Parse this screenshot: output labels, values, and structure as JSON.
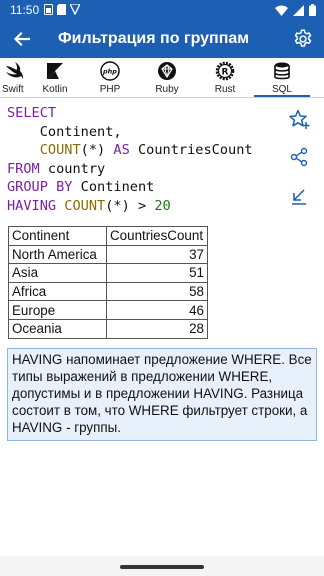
{
  "status_bar": {
    "time": "11:50",
    "icons": [
      "sim-icon",
      "sd-card-icon",
      "vpn-shield-icon",
      "wifi-icon",
      "signal-icon",
      "battery-icon"
    ]
  },
  "app_bar": {
    "title": "Фильтрация по группам",
    "back_icon": "arrow-left-icon",
    "settings_icon": "gear-icon"
  },
  "tabs": [
    {
      "label": "Swift",
      "icon": "swift-icon"
    },
    {
      "label": "Kotlin",
      "icon": "kotlin-icon"
    },
    {
      "label": "PHP",
      "icon": "php-icon"
    },
    {
      "label": "Ruby",
      "icon": "ruby-icon"
    },
    {
      "label": "Rust",
      "icon": "rust-icon"
    },
    {
      "label": "SQL",
      "icon": "database-icon",
      "active": true
    }
  ],
  "code": {
    "line1_kw": "SELECT",
    "line2_text": "    Continent,",
    "line3_indent": "    ",
    "line3_fn": "COUNT",
    "line3_args": "(*) ",
    "line3_kw": "AS",
    "line3_alias": " CountriesCount",
    "line4_kw": "FROM",
    "line4_text": " country",
    "line5_kw": "GROUP BY",
    "line5_text": " Continent",
    "line6_kw": "HAVING",
    "line6_sp": " ",
    "line6_fn": "COUNT",
    "line6_text": "(*) > ",
    "line6_num": "20"
  },
  "side_actions": [
    "star-plus-icon",
    "share-icon",
    "collapse-icon"
  ],
  "table": {
    "headers": [
      "Continent",
      "CountriesCount"
    ],
    "rows": [
      [
        "North America",
        "37"
      ],
      [
        "Asia",
        "51"
      ],
      [
        "Africa",
        "58"
      ],
      [
        "Europe",
        "46"
      ],
      [
        "Oceania",
        "28"
      ]
    ]
  },
  "note": {
    "text": "HAVING напоминает предложение WHERE. Все типы выражений в предложении WHERE, допустимы и в предложении HAVING. Разница состоит в том, что WHERE фильтрует строки, а HAVING - группы."
  },
  "colors": {
    "primary": "#1c5fb3",
    "keyword": "#7c1fa6",
    "function": "#8a6d00",
    "number": "#1a7a1a",
    "note_background": "#e8f1fb"
  }
}
